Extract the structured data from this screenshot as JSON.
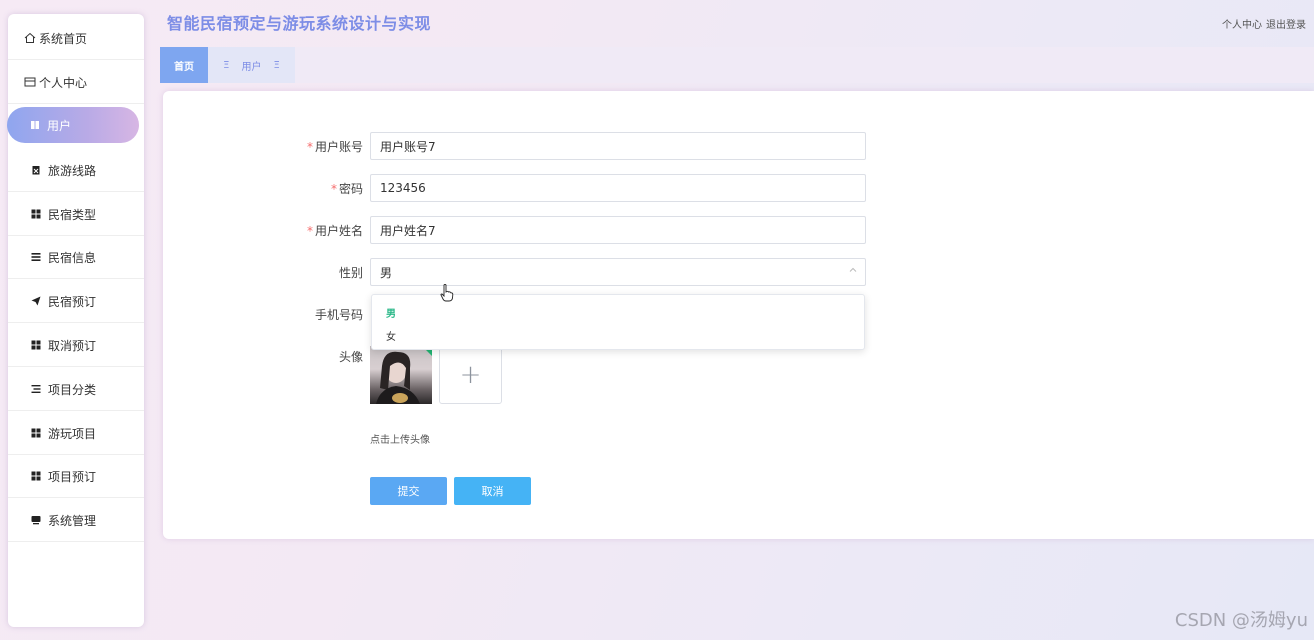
{
  "app": {
    "title": "智能民宿预定与游玩系统设计与实现"
  },
  "header": {
    "links": [
      "个人中心",
      "退出登录"
    ]
  },
  "sidebar": {
    "items": [
      {
        "label": "系统首页",
        "icon": "home-icon"
      },
      {
        "label": "个人中心",
        "icon": "card-icon"
      },
      {
        "label": "用户",
        "icon": "grid-icon",
        "active": true
      },
      {
        "label": "旅游线路",
        "icon": "clipboard-icon"
      },
      {
        "label": "民宿类型",
        "icon": "grid-icon"
      },
      {
        "label": "民宿信息",
        "icon": "list-icon"
      },
      {
        "label": "民宿预订",
        "icon": "send-icon"
      },
      {
        "label": "取消预订",
        "icon": "grid-icon"
      },
      {
        "label": "项目分类",
        "icon": "list-icon"
      },
      {
        "label": "游玩项目",
        "icon": "grid-icon"
      },
      {
        "label": "项目预订",
        "icon": "grid-icon"
      },
      {
        "label": "系统管理",
        "icon": "monitor-icon"
      }
    ]
  },
  "tabs": {
    "home": "首页",
    "current": "用户",
    "current_prefix": "Ξ",
    "current_suffix": "Ξ"
  },
  "form": {
    "account": {
      "label": "用户账号",
      "value": "用户账号7",
      "required": true
    },
    "password": {
      "label": "密码",
      "value": "123456",
      "required": true
    },
    "name": {
      "label": "用户姓名",
      "value": "用户姓名7",
      "required": true
    },
    "gender": {
      "label": "性别",
      "value": "男",
      "options": [
        "男",
        "女"
      ],
      "selected": "男"
    },
    "phone": {
      "label": "手机号码",
      "value": ""
    },
    "avatar": {
      "label": "头像",
      "hint": "点击上传头像",
      "upload_glyph": "+"
    },
    "required_mark": "*"
  },
  "buttons": {
    "submit": "提交",
    "cancel": "取消"
  },
  "watermark": "CSDN @汤姆yu",
  "colors": {
    "accent": "#7d8de6",
    "submit": "#5aa8f3",
    "cancel": "#45b3f5",
    "selected_option": "#2db98a"
  }
}
